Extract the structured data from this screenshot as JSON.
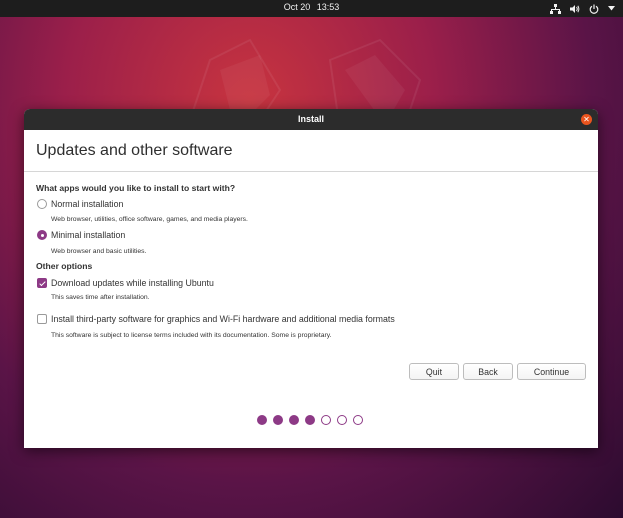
{
  "topbar": {
    "date": "Oct 20",
    "time": "13:53",
    "icons": [
      "network-icon",
      "volume-icon",
      "power-icon",
      "menu-arrow-icon"
    ]
  },
  "window": {
    "title": "Install",
    "close_icon": "close-icon",
    "accent_color": "#8d3a86",
    "titlebar_color": "#2c2c2c"
  },
  "page": {
    "heading": "Updates and other software",
    "question": "What apps would you like to install to start with?",
    "install_options": [
      {
        "label": "Normal installation",
        "description": "Web browser, utilities, office software, games, and media players.",
        "selected": false
      },
      {
        "label": "Minimal installation",
        "description": "Web browser and basic utilities.",
        "selected": true
      }
    ],
    "other_options_title": "Other options",
    "other_options": [
      {
        "label": "Download updates while installing Ubuntu",
        "description": "This saves time after installation.",
        "checked": true
      },
      {
        "label": "Install third-party software for graphics and Wi-Fi hardware and additional media formats",
        "description": "This software is subject to license terms included with its documentation. Some is proprietary.",
        "checked": false
      }
    ]
  },
  "buttons": {
    "quit": "Quit",
    "back": "Back",
    "continue": "Continue"
  },
  "progress": {
    "total_steps": 7,
    "completed_steps": 4
  }
}
